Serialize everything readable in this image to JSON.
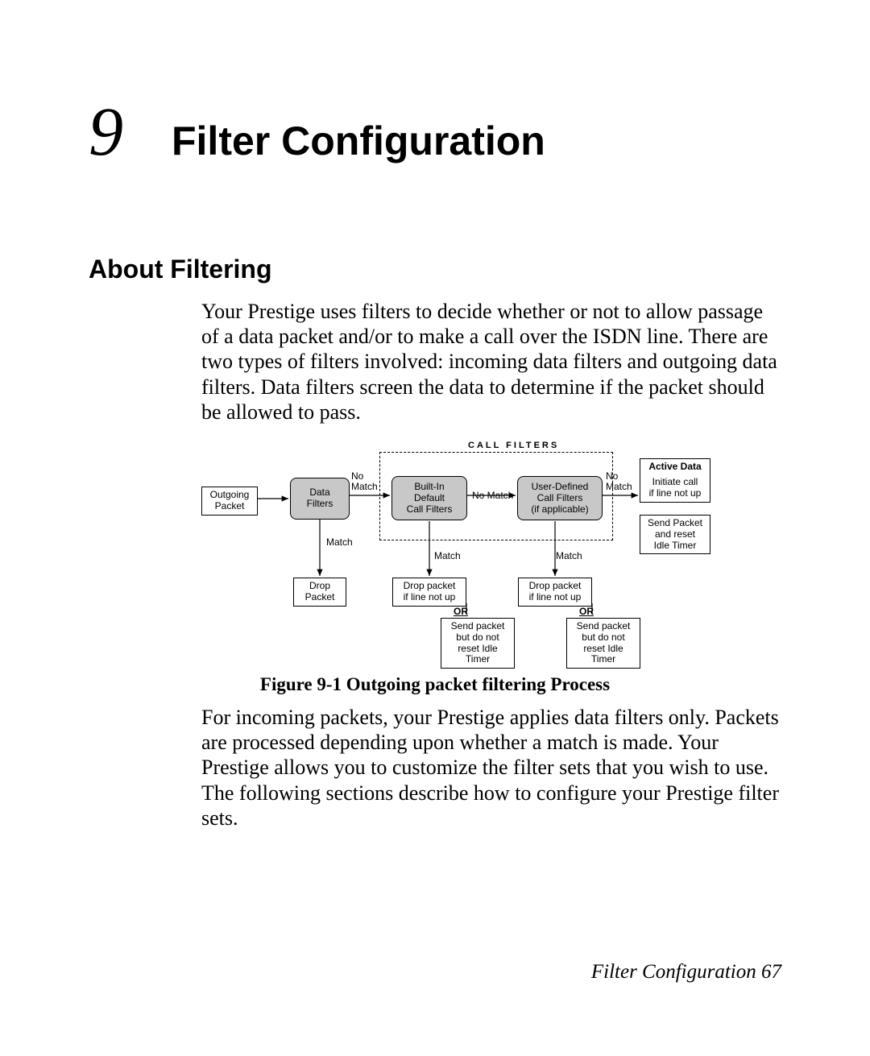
{
  "chapter": {
    "number": "9",
    "title": "Filter Configuration"
  },
  "section": {
    "heading": "About Filtering",
    "para1": "Your Prestige uses filters to decide whether or not to allow passage of a data packet and/or to make a call over the ISDN line. There are two types of filters involved: incoming data filters and outgoing data filters. Data filters screen the data to determine if the packet should be allowed to pass.",
    "para2": "For incoming packets, your Prestige applies data filters only. Packets are processed depending upon whether a match is made. Your Prestige allows you to customize the filter sets that you wish to use. The following sections describe how to configure your Prestige filter sets."
  },
  "figure": {
    "caption": "Figure 9-1 Outgoing packet filtering Process"
  },
  "diagram": {
    "group_label": "CALL FILTERS",
    "outgoing_packet": "Outgoing\nPacket",
    "data_filters": "Data\nFilters",
    "builtin": "Built-In\nDefault\nCall Filters",
    "userdef": "User-Defined\nCall Filters\n(if applicable)",
    "active_data": "Active Data",
    "active_actions": "Initiate call\nif line not up",
    "active_actions2": "Send Packet\nand reset\nIdle Timer",
    "no_match": "No\nMatch",
    "no_match_mid": "No Match",
    "match": "Match",
    "drop_packet": "Drop\nPacket",
    "drop_ln": "Drop packet\nif line not up",
    "or": "OR",
    "send_noreset": "Send packet\nbut do not\nreset Idle Timer"
  },
  "footer": {
    "text": "Filter Configuration  67"
  }
}
